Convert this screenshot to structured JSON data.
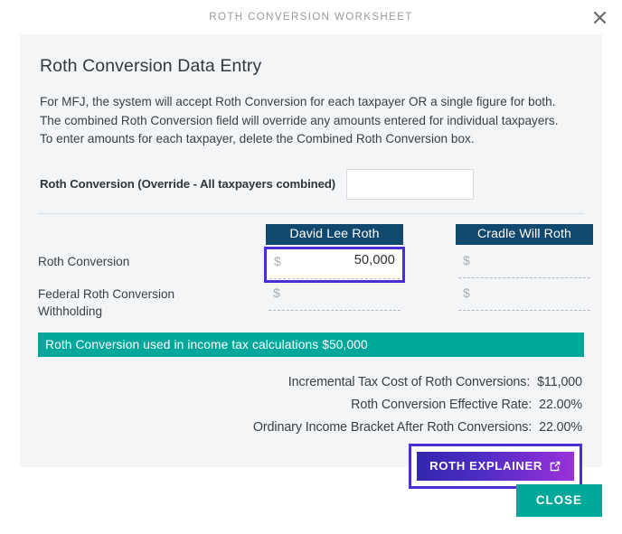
{
  "window": {
    "title": "ROTH CONVERSION WORKSHEET",
    "close_icon": "close-x-icon"
  },
  "card": {
    "heading": "Roth Conversion Data Entry",
    "description": [
      "For MFJ, the system will accept Roth Conversion for each taxpayer OR a single figure for both.",
      "The combined Roth Conversion field will override any amounts entered for individual taxpayers.",
      "To enter amounts for each taxpayer, delete the Combined Roth Conversion box."
    ],
    "override": {
      "label": "Roth Conversion (Override - All taxpayers combined)",
      "value": "",
      "placeholder": ""
    },
    "columns": [
      {
        "name": "David Lee Roth"
      },
      {
        "name": "Cradle Will Roth"
      }
    ],
    "rows": [
      {
        "label": "Roth Conversion",
        "david": {
          "currency": "$",
          "value": "50,000",
          "focused": true
        },
        "cradle": {
          "currency": "$",
          "value": "",
          "focused": false
        }
      },
      {
        "label": "Federal Roth Conversion Withholding",
        "label_line1": "Federal Roth Conversion",
        "label_line2": "Withholding",
        "david": {
          "currency": "$",
          "value": "",
          "focused": false
        },
        "cradle": {
          "currency": "$",
          "value": "",
          "focused": false
        }
      }
    ],
    "result_bar": "Roth Conversion used in income tax calculations $50,000",
    "summary": [
      {
        "label": "Incremental Tax Cost of Roth Conversions:",
        "value": "$11,000"
      },
      {
        "label": "Roth Conversion Effective Rate:",
        "value": "22.00%"
      },
      {
        "label": "Ordinary Income Bracket After Roth Conversions:",
        "value": "22.00%"
      }
    ],
    "explainer_button": {
      "label": "ROTH EXPLAINER",
      "icon": "external-link-icon"
    }
  },
  "footer": {
    "close_label": "CLOSE"
  },
  "colors": {
    "header_navy": "#11496e",
    "teal": "#00a79b",
    "focus_purple": "#4a2fd4",
    "gradient_start": "#3426ad",
    "gradient_end": "#9b31d9",
    "card_bg": "#f3f5f7"
  }
}
